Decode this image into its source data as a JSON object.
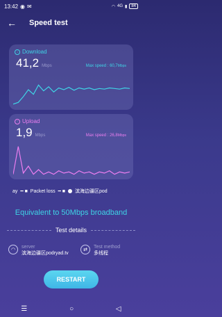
{
  "status": {
    "time": "13:42",
    "network": "4G",
    "battery": "84"
  },
  "header": {
    "title": "Speed test"
  },
  "download": {
    "label": "Download",
    "value": "41,2",
    "unit": "Mbps",
    "max_label": "Max speed : 60,7",
    "max_unit": "Mbps",
    "color": "#3fd4e6"
  },
  "upload": {
    "label": "Upload",
    "value": "1,9",
    "unit": "Mbps",
    "max_label": "Max speed : 26,8",
    "max_unit": "Mbps",
    "color": "#ec7ef0"
  },
  "ticker": {
    "text1": "ay",
    "text2": "Packet loss",
    "text3": "滨海边疆区pod"
  },
  "equivalent": "Equivalent to 50Mbps broadband",
  "details": {
    "title": "Test details",
    "server_label": "server",
    "server_value": "滨海边疆区podryad.tv",
    "method_label": "Test method",
    "method_value": "多线程"
  },
  "button": {
    "restart": "RESTART"
  },
  "chart_data": [
    {
      "type": "line",
      "series": [
        {
          "values": [
            5,
            8,
            18,
            30,
            22,
            38,
            28,
            35,
            26,
            33,
            30,
            34,
            29,
            33,
            31,
            33,
            30,
            32,
            31,
            33,
            32,
            31,
            33,
            32
          ]
        }
      ],
      "ylim": [
        0,
        60
      ]
    },
    {
      "type": "line",
      "series": [
        {
          "values": [
            2,
            26,
            3,
            9,
            2,
            6,
            2,
            4,
            2,
            5,
            3,
            4,
            2,
            5,
            3,
            4,
            2,
            4,
            3,
            5,
            2,
            4,
            3,
            4
          ]
        }
      ],
      "ylim": [
        0,
        30
      ]
    }
  ]
}
